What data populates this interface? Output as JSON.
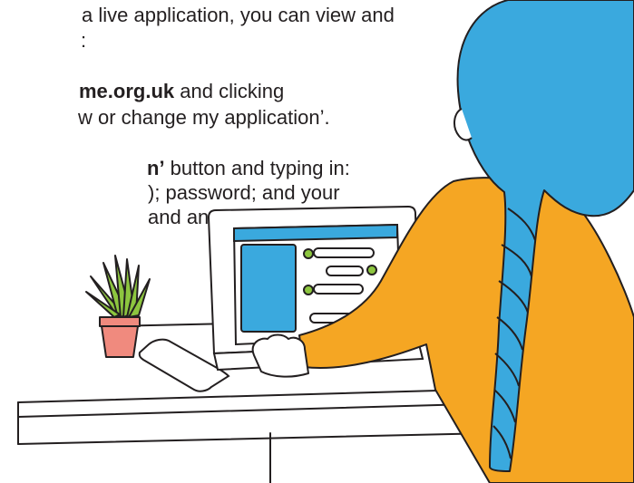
{
  "text": {
    "line1": "a live application, you can view and",
    "line2": ":",
    "line3_bold": "me.org.uk",
    "line3_rest": " and clicking",
    "line4": "w or change my application’.",
    "line5_bold": "n’",
    "line5_rest": " button and typing in:",
    "line6": "); password; and your",
    "line7": "and answer."
  },
  "colors": {
    "hair": "#3aa9de",
    "sweater": "#f5a623",
    "screen_blue": "#3aa9de",
    "dot_green": "#8dc63f",
    "pot": "#f08a7e",
    "plant": "#8dc63f",
    "outline": "#231f20"
  },
  "icons": [
    "person-illustration",
    "laptop-illustration",
    "plant-illustration",
    "phone-illustration"
  ]
}
